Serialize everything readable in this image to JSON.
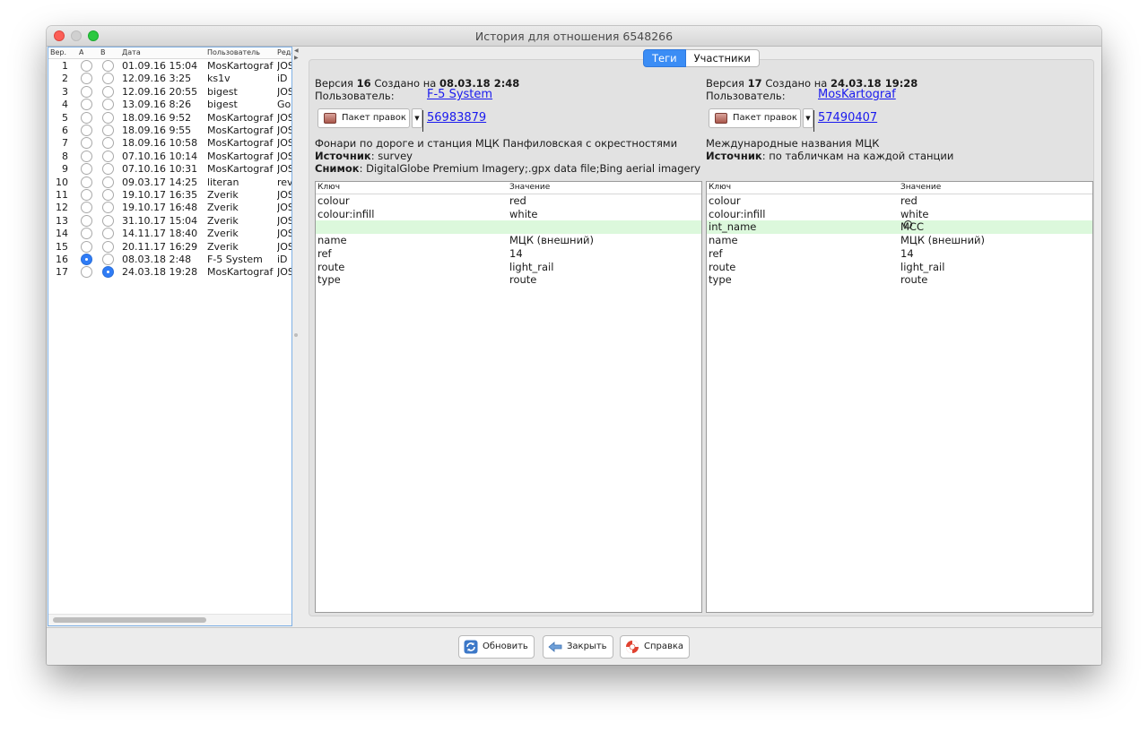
{
  "window": {
    "title": "История для отношения 6548266"
  },
  "history": {
    "headers": {
      "ver": "Вер.",
      "a": "A",
      "b": "B",
      "date": "Дата",
      "user": "Пользователь",
      "editor": "Реда"
    },
    "rows": [
      {
        "ver": "1",
        "date": "01.09.16 15:04",
        "user": "MosKartograf",
        "editor": "JOS",
        "a": false,
        "b": false
      },
      {
        "ver": "2",
        "date": "12.09.16 3:25",
        "user": "ks1v",
        "editor": "iD",
        "a": false,
        "b": false
      },
      {
        "ver": "3",
        "date": "12.09.16 20:55",
        "user": "bigest",
        "editor": "JOS",
        "a": false,
        "b": false
      },
      {
        "ver": "4",
        "date": "13.09.16 8:26",
        "user": "bigest",
        "editor": "Go",
        "a": false,
        "b": false
      },
      {
        "ver": "5",
        "date": "18.09.16 9:52",
        "user": "MosKartograf",
        "editor": "JOS",
        "a": false,
        "b": false
      },
      {
        "ver": "6",
        "date": "18.09.16 9:55",
        "user": "MosKartograf",
        "editor": "JOS",
        "a": false,
        "b": false
      },
      {
        "ver": "7",
        "date": "18.09.16 10:58",
        "user": "MosKartograf",
        "editor": "JOS",
        "a": false,
        "b": false
      },
      {
        "ver": "8",
        "date": "07.10.16 10:14",
        "user": "MosKartograf",
        "editor": "JOS",
        "a": false,
        "b": false
      },
      {
        "ver": "9",
        "date": "07.10.16 10:31",
        "user": "MosKartograf",
        "editor": "JOS",
        "a": false,
        "b": false
      },
      {
        "ver": "10",
        "date": "09.03.17 14:25",
        "user": "literan",
        "editor": "rev",
        "a": false,
        "b": false
      },
      {
        "ver": "11",
        "date": "19.10.17 16:35",
        "user": "Zverik",
        "editor": "JOS",
        "a": false,
        "b": false
      },
      {
        "ver": "12",
        "date": "19.10.17 16:48",
        "user": "Zverik",
        "editor": "JOS",
        "a": false,
        "b": false
      },
      {
        "ver": "13",
        "date": "31.10.17 15:04",
        "user": "Zverik",
        "editor": "JOS",
        "a": false,
        "b": false
      },
      {
        "ver": "14",
        "date": "14.11.17 18:40",
        "user": "Zverik",
        "editor": "JOS",
        "a": false,
        "b": false
      },
      {
        "ver": "15",
        "date": "20.11.17 16:29",
        "user": "Zverik",
        "editor": "JOS",
        "a": false,
        "b": false
      },
      {
        "ver": "16",
        "date": "08.03.18 2:48",
        "user": "F-5 System",
        "editor": "iD .",
        "a": true,
        "b": false
      },
      {
        "ver": "17",
        "date": "24.03.18 19:28",
        "user": "MosKartograf",
        "editor": "JOS",
        "a": false,
        "b": true
      }
    ]
  },
  "tabs": {
    "tags": "Теги",
    "members": "Участники"
  },
  "left_version": {
    "version_label": "Версия",
    "version": "16",
    "created_label": "Создано на",
    "created": "08.03.18 2:48",
    "user_label": "Пользователь:",
    "user": "F-5 System",
    "changeset_button": "Пакет правок",
    "changeset_id": "56983879",
    "comment": "Фонари по дороге и станция МЦК Панфиловская с окрестностями",
    "source_label": "Источник",
    "source": ": survey",
    "imagery_label": "Снимок",
    "imagery": ": DigitalGlobe Premium Imagery;.gpx data file;Bing aerial imagery"
  },
  "right_version": {
    "version_label": "Версия",
    "version": "17",
    "created_label": "Создано на",
    "created": "24.03.18 19:28",
    "user_label": "Пользователь:",
    "user": "MosKartograf",
    "changeset_button": "Пакет правок",
    "changeset_id": "57490407",
    "comment": "Международные названия МЦК",
    "source_label": "Источник",
    "source": ": по табличкам на каждой станции"
  },
  "table_headers": {
    "key": "Ключ",
    "value": "Значение"
  },
  "left_tags": [
    {
      "k": "colour",
      "v": "red",
      "added": false
    },
    {
      "k": "colour:infill",
      "v": "white",
      "added": false
    },
    {
      "k": "",
      "v": "",
      "added": true
    },
    {
      "k": "name",
      "v": "МЦК (внешний)",
      "added": false
    },
    {
      "k": "ref",
      "v": "14",
      "added": false
    },
    {
      "k": "route",
      "v": "light_rail",
      "added": false
    },
    {
      "k": "type",
      "v": "route",
      "added": false
    }
  ],
  "right_tags": [
    {
      "k": "colour",
      "v": "red",
      "added": false
    },
    {
      "k": "colour:infill",
      "v": "white",
      "added": false
    },
    {
      "k": "int_name",
      "v": "MCC",
      "added": true
    },
    {
      "k": "name",
      "v": "МЦК (внешний)",
      "added": false
    },
    {
      "k": "ref",
      "v": "14",
      "added": false
    },
    {
      "k": "route",
      "v": "light_rail",
      "added": false
    },
    {
      "k": "type",
      "v": "route",
      "added": false
    }
  ],
  "buttons": {
    "refresh": "Обновить",
    "close": "Закрыть",
    "help": "Справка"
  },
  "colors": {
    "accent": "#3b8df5",
    "added_row": "#dcf8dc",
    "link": "#1a1aee"
  }
}
